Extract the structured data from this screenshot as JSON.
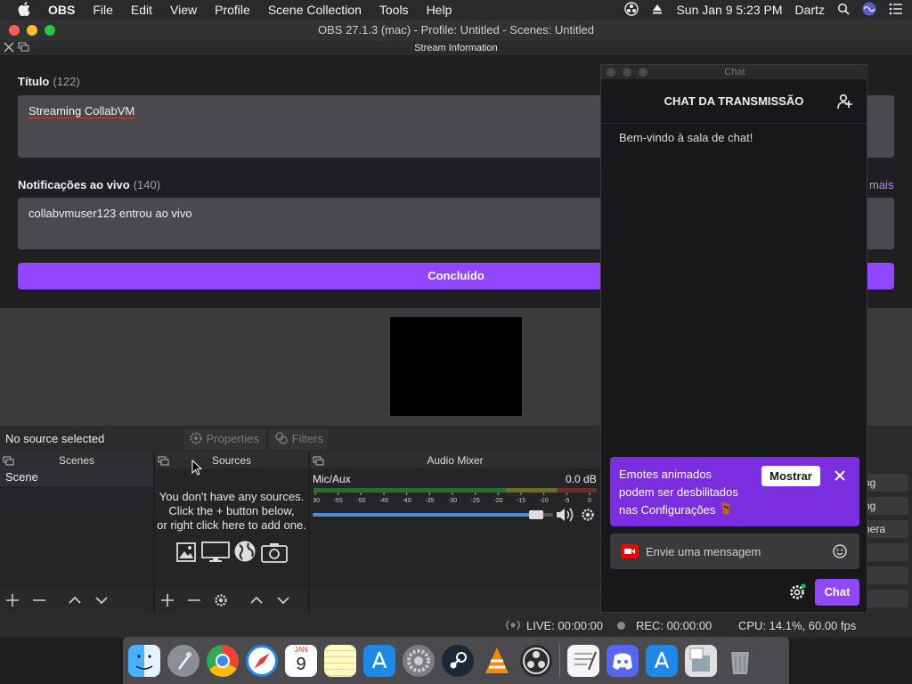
{
  "menubar": {
    "app": "OBS",
    "items": [
      "File",
      "Edit",
      "View",
      "Profile",
      "Scene Collection",
      "Tools",
      "Help"
    ],
    "datetime": "Sun Jan 9  5:23 PM",
    "user": "Dartz"
  },
  "window": {
    "title": "OBS 27.1.3 (mac) - Profile: Untitled - Scenes: Untitled",
    "dock_title": "Stream Information"
  },
  "stream_info": {
    "title_label": "Título",
    "title_count": "(122)",
    "title_value": "Streaming CollabVM",
    "notif_label": "Notificações ao vivo",
    "notif_count": "(140)",
    "notif_value": "collabvmuser123 entrou ao vivo",
    "more_link": "mais",
    "done_button": "Concluído"
  },
  "source_toolbar": {
    "no_source": "No source selected",
    "properties": "Properties",
    "filters": "Filters"
  },
  "docks": {
    "scenes": {
      "title": "Scenes",
      "items": [
        "Scene"
      ]
    },
    "sources": {
      "title": "Sources",
      "empty_line1": "You don't have any sources.",
      "empty_line2": "Click the + button below,",
      "empty_line3": "or right click here to add one."
    },
    "audio": {
      "title": "Audio Mixer",
      "channel": "Mic/Aux",
      "db": "0.0 dB",
      "ticks": [
        "-60",
        "-55",
        "-50",
        "-45",
        "-40",
        "-35",
        "-30",
        "-25",
        "-20",
        "-15",
        "-10",
        "-5",
        "0"
      ],
      "volume_level": 0.95
    },
    "controls_partial": [
      "ng",
      "ng",
      "nera"
    ]
  },
  "status": {
    "live": "LIVE: 00:00:00",
    "rec": "REC: 00:00:00",
    "cpu": "CPU: 14.1%, 60.00 fps"
  },
  "chat": {
    "window_title": "Chat",
    "header": "CHAT DA TRANSMISSÃO",
    "welcome": "Bem-vindo à sala de chat!",
    "banner_line1": "Emotes animados",
    "banner_line2": "podem ser desbilitados",
    "banner_line3": "nas Configurações",
    "banner_button": "Mostrar",
    "input_placeholder": "Envie uma mensagem",
    "chat_button": "Chat"
  },
  "colors": {
    "accent": "#9147ff",
    "banner": "#7a2ee0",
    "close_red": "#fe5f57",
    "minimize_yellow": "#febc2e",
    "zoom_green": "#28c840"
  },
  "dock_apps": [
    "finder-icon",
    "launchpad-icon",
    "chrome-icon",
    "safari-icon",
    "calendar-icon",
    "notes-icon",
    "app-store-icon",
    "system-preferences-icon",
    "steam-icon",
    "vlc-icon",
    "obs-icon",
    "textedit-icon",
    "discord-icon",
    "app-store-icon",
    "preview-icon",
    "trash-icon"
  ],
  "calendar": {
    "month": "JAN",
    "day": "9"
  }
}
